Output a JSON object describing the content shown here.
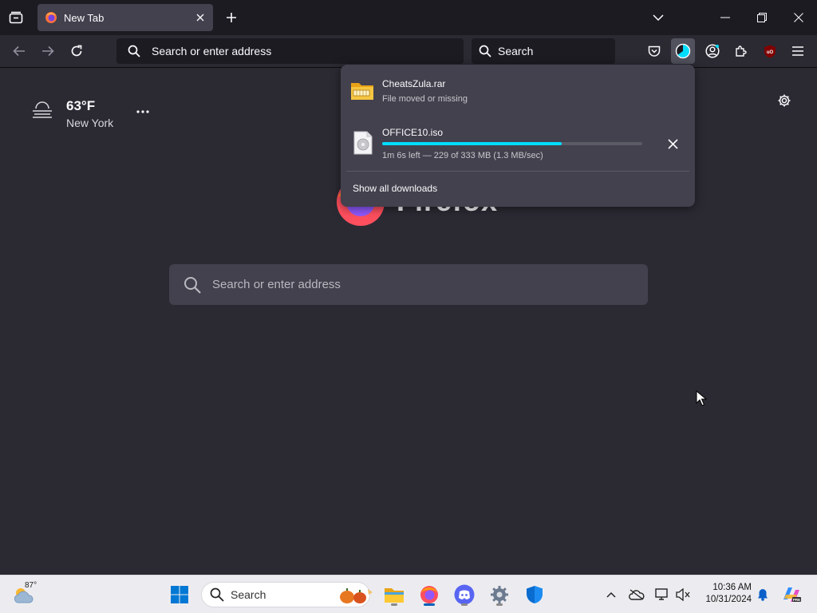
{
  "tabs": [
    {
      "title": "New Tab",
      "active": true
    }
  ],
  "navbar": {
    "url_placeholder": "Search or enter address",
    "search_placeholder": "Search"
  },
  "weather": {
    "temperature": "63°F",
    "location": "New York",
    "icon": "fog-icon"
  },
  "newtab": {
    "search_placeholder": "Search or enter address",
    "logo_text": "Firefox"
  },
  "downloads": {
    "items": [
      {
        "name": "CheatsZula.rar",
        "status": "File moved or missing",
        "icon": "archive-icon"
      },
      {
        "name": "OFFICE10.iso",
        "status": "1m 6s left — 229 of 333 MB (1.3 MB/sec)",
        "progress": 0.69,
        "icon": "disc-file-icon"
      }
    ],
    "show_all_label": "Show all downloads"
  },
  "taskbar": {
    "weather_temp": "87°",
    "search_label": "Search",
    "time": "10:36 AM",
    "date": "10/31/2024"
  },
  "colors": {
    "accent": "#00ddff",
    "toolbar": "#2b2a33",
    "panel": "#42414d",
    "taskbar_accent": "#005fb8"
  }
}
